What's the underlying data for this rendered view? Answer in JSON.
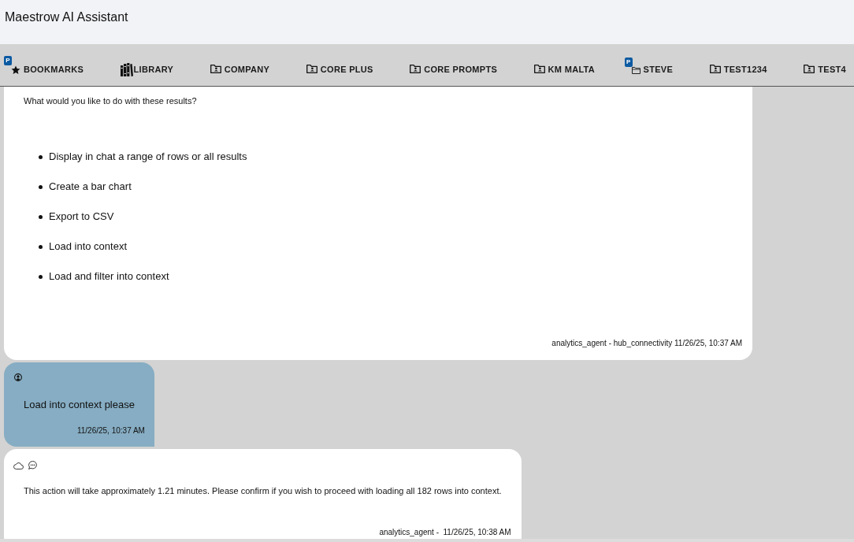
{
  "app": {
    "title": "Maestrow AI Assistant"
  },
  "tabs": [
    {
      "label": "BOOKMARKS",
      "kind": "bookmarks",
      "badge": "P"
    },
    {
      "label": "LIBRARY",
      "kind": "library"
    },
    {
      "label": "COMPANY",
      "kind": "shared"
    },
    {
      "label": "CORE PLUS",
      "kind": "shared"
    },
    {
      "label": "CORE PROMPTS",
      "kind": "shared"
    },
    {
      "label": "KM MALTA",
      "kind": "shared"
    },
    {
      "label": "STEVE",
      "kind": "private",
      "badge": "P"
    },
    {
      "label": "TEST1234",
      "kind": "shared"
    },
    {
      "label": "TEST4",
      "kind": "shared"
    }
  ],
  "messages": [
    {
      "kind": "agent",
      "continued": true,
      "text": "What would you like to do with these results?",
      "options": [
        "Display in chat a range of rows or all results",
        "Create a bar chart",
        "Export to CSV",
        "Load into context",
        "Load and filter into context"
      ],
      "meta": "analytics_agent - hub_connectivity 11/26/25, 10:37 AM"
    },
    {
      "kind": "user",
      "continued": false,
      "text": "Load into context please",
      "meta": "11/26/25, 10:37 AM"
    },
    {
      "kind": "agent",
      "continued": false,
      "text": "This action will take approximately 1.21 minutes. Please confirm if you wish to proceed with loading all 182 rows into context.",
      "meta": "analytics_agent -  11/26/25, 10:38 AM"
    }
  ]
}
